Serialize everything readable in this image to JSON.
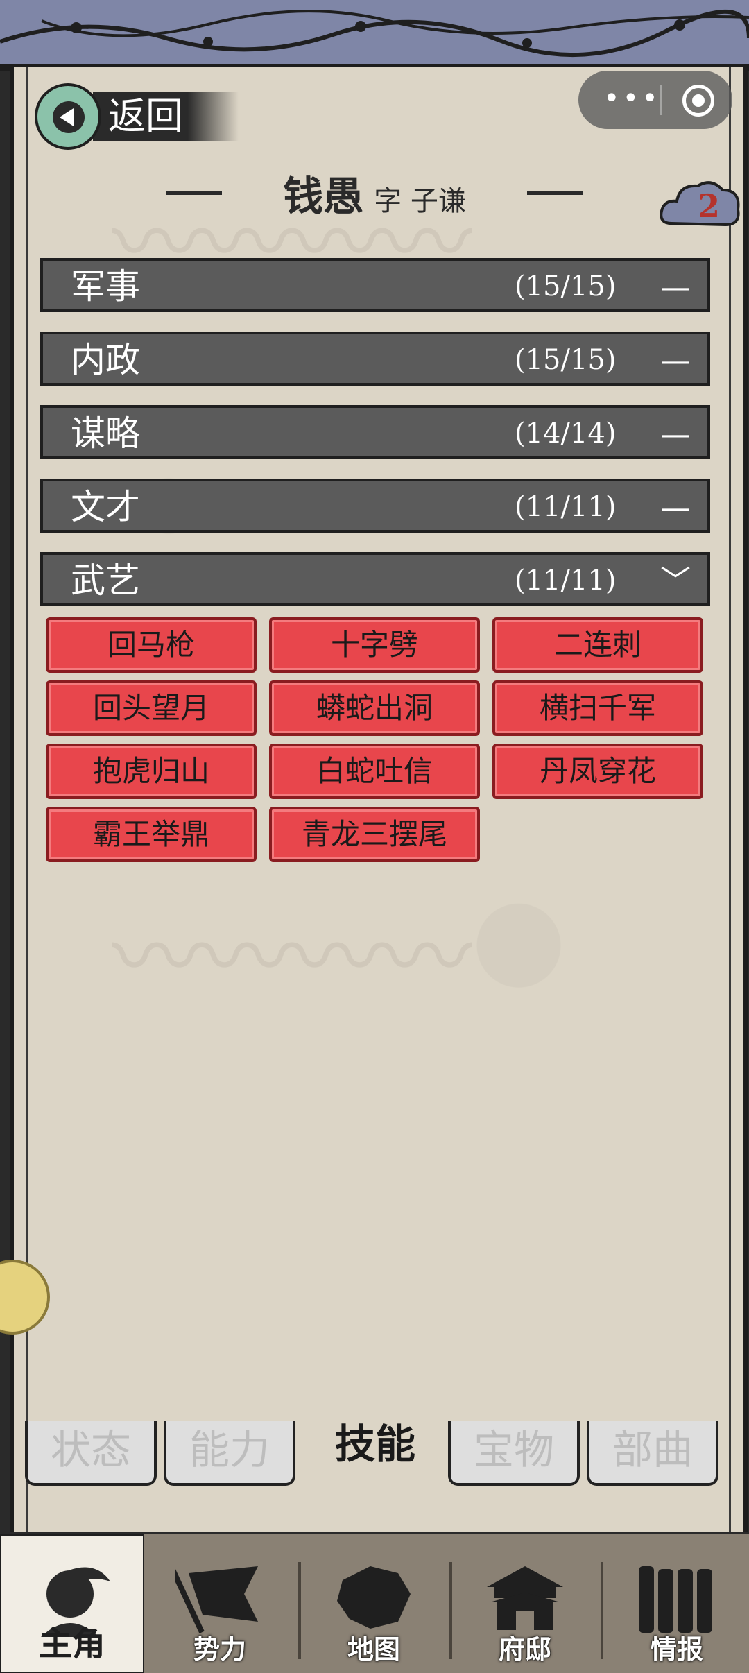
{
  "header": {
    "back_label": "返回",
    "more_icon": "more-dots-icon",
    "close_icon": "record-circle-icon"
  },
  "character": {
    "name": "钱愚",
    "style_name": "字 子谦",
    "badge_count": "2"
  },
  "categories": [
    {
      "name": "军事",
      "count": "(15/15)",
      "toggle": "—"
    },
    {
      "name": "内政",
      "count": "(15/15)",
      "toggle": "—"
    },
    {
      "name": "谋略",
      "count": "(14/14)",
      "toggle": "—"
    },
    {
      "name": "文才",
      "count": "(11/11)",
      "toggle": "—"
    },
    {
      "name": "武艺",
      "count": "(11/11)",
      "toggle": "﹀"
    }
  ],
  "skills": [
    "回马枪",
    "十字劈",
    "二连刺",
    "回头望月",
    "蟒蛇出洞",
    "横扫千军",
    "抱虎归山",
    "白蛇吐信",
    "丹凤穿花",
    "霸王举鼎",
    "青龙三摆尾"
  ],
  "tabs": [
    "状态",
    "能力",
    "技能",
    "宝物",
    "部曲"
  ],
  "active_tab": "技能",
  "bottom_nav": [
    "主角",
    "势力",
    "地图",
    "府邸",
    "情报"
  ],
  "active_nav": "主角",
  "colors": {
    "category_bar": "#5b5b5b",
    "skill_red": "#e8464c",
    "badge_red": "#b5332c",
    "back_teal": "#8bc2aa",
    "banner_blue": "#7f86a7"
  }
}
